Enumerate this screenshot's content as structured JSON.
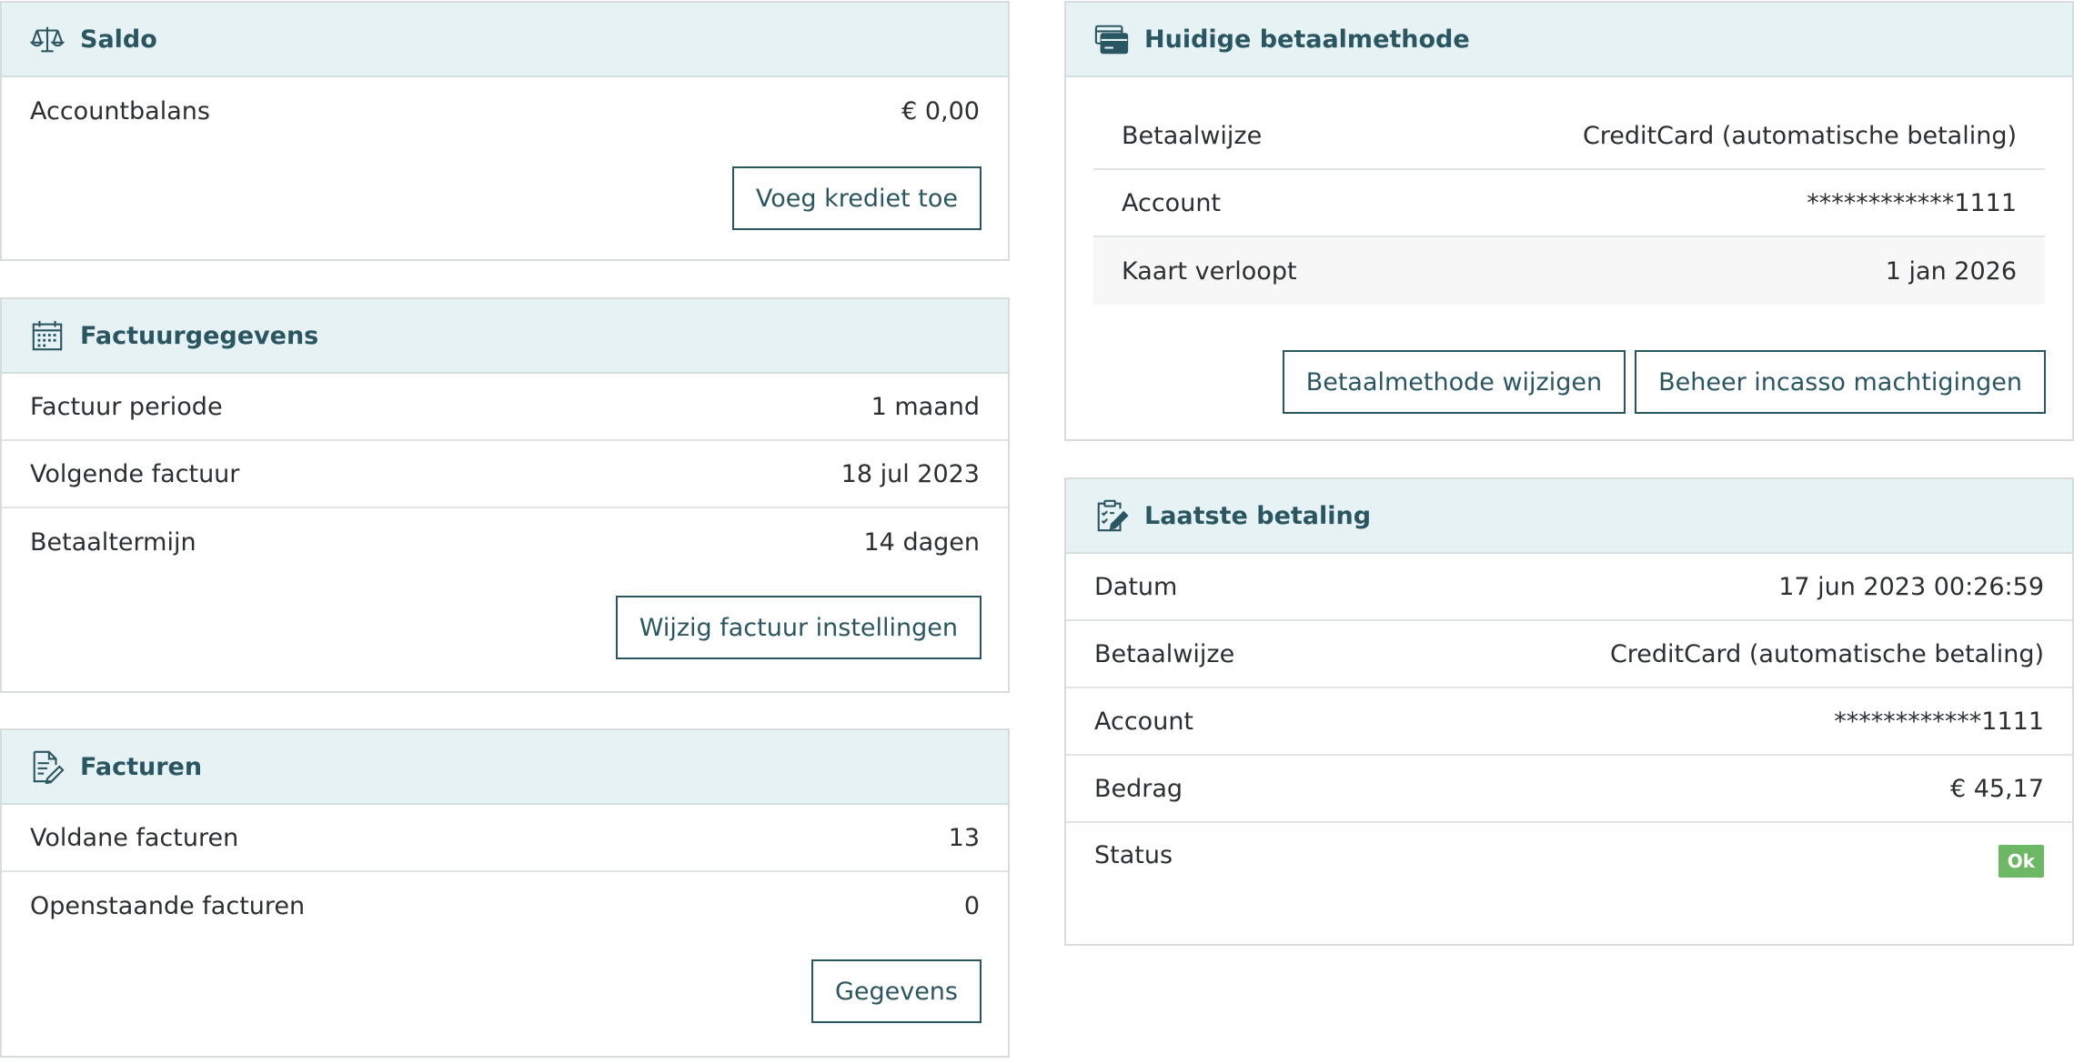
{
  "saldo": {
    "title": "Saldo",
    "icon": "scale-icon",
    "rows": [
      {
        "label": "Accountbalans",
        "value": "€ 0,00"
      }
    ],
    "button": "Voeg krediet toe"
  },
  "factuurgegevens": {
    "title": "Factuurgegevens",
    "icon": "calendar-icon",
    "rows": [
      {
        "label": "Factuur periode",
        "value": "1 maand"
      },
      {
        "label": "Volgende factuur",
        "value": "18 jul 2023"
      },
      {
        "label": "Betaaltermijn",
        "value": "14 dagen"
      }
    ],
    "button": "Wijzig factuur instellingen"
  },
  "facturen": {
    "title": "Facturen",
    "icon": "document-edit-icon",
    "rows": [
      {
        "label": "Voldane facturen",
        "value": "13"
      },
      {
        "label": "Openstaande facturen",
        "value": "0"
      }
    ],
    "button": "Gegevens"
  },
  "betaalmethode": {
    "title": "Huidige betaalmethode",
    "icon": "credit-card-icon",
    "rows": [
      {
        "label": "Betaalwijze",
        "value": "CreditCard (automatische betaling)"
      },
      {
        "label": "Account",
        "value": "************1111"
      },
      {
        "label": "Kaart verloopt",
        "value": "1 jan 2026"
      }
    ],
    "buttons": [
      "Betaalmethode wijzigen",
      "Beheer incasso machtigingen"
    ]
  },
  "laatste_betaling": {
    "title": "Laatste betaling",
    "icon": "clipboard-check-icon",
    "rows": [
      {
        "label": "Datum",
        "value": "17 jun 2023 00:26:59"
      },
      {
        "label": "Betaalwijze",
        "value": "CreditCard (automatische betaling)"
      },
      {
        "label": "Account",
        "value": "************1111"
      },
      {
        "label": "Bedrag",
        "value": "€ 45,17"
      }
    ],
    "status_label": "Status",
    "status_value": "Ok",
    "status_color": "#6cb865"
  },
  "colors": {
    "accent": "#2a5662",
    "header_bg": "#e6f2f3"
  }
}
